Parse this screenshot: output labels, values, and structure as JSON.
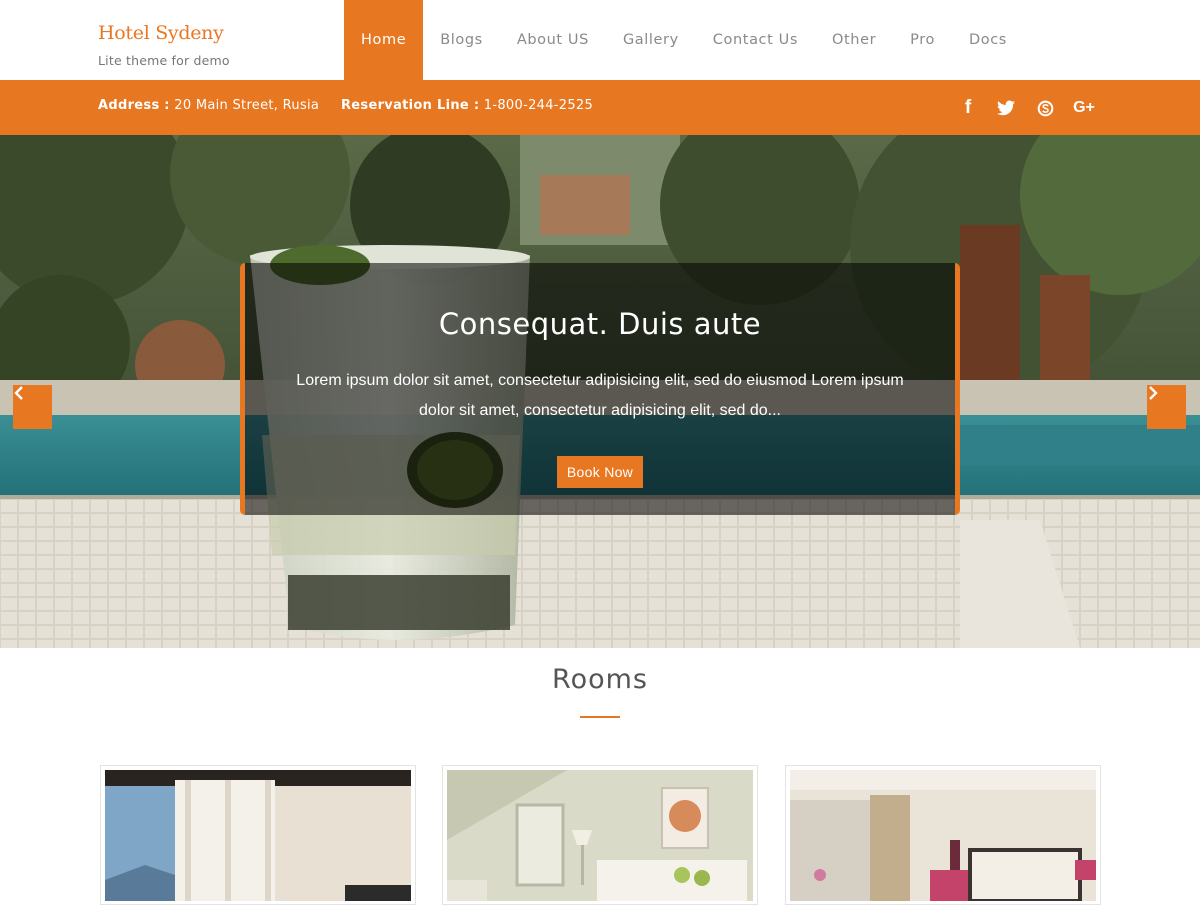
{
  "site": {
    "title": "Hotel Sydeny",
    "tagline": "Lite theme for demo"
  },
  "nav": {
    "items": [
      {
        "label": "Home",
        "active": true
      },
      {
        "label": "Blogs"
      },
      {
        "label": "About US"
      },
      {
        "label": "Gallery"
      },
      {
        "label": "Contact Us"
      },
      {
        "label": "Other"
      },
      {
        "label": "Pro"
      },
      {
        "label": "Docs"
      }
    ]
  },
  "infobar": {
    "address_label": "Address :",
    "address_value": "20 Main Street, Rusia",
    "reservation_label": "Reservation Line :",
    "reservation_value": "1-800-244-2525",
    "social": [
      {
        "icon": "facebook-icon",
        "glyph": "f"
      },
      {
        "icon": "twitter-icon"
      },
      {
        "icon": "skype-icon"
      },
      {
        "icon": "google-plus-icon",
        "glyph": "G+"
      }
    ]
  },
  "slider": {
    "title": "Consequat. Duis aute",
    "text": "Lorem ipsum dolor sit amet, consectetur adipisicing elit, sed do eiusmod Lorem ipsum dolor sit amet, consectetur adipisicing elit, sed do...",
    "button": "Book Now",
    "prev_icon": "chevron-left-icon",
    "next_icon": "chevron-right-icon"
  },
  "rooms": {
    "title": "Rooms"
  },
  "colors": {
    "accent": "#e87722",
    "text": "#555555",
    "muted": "#8a8a8a"
  }
}
